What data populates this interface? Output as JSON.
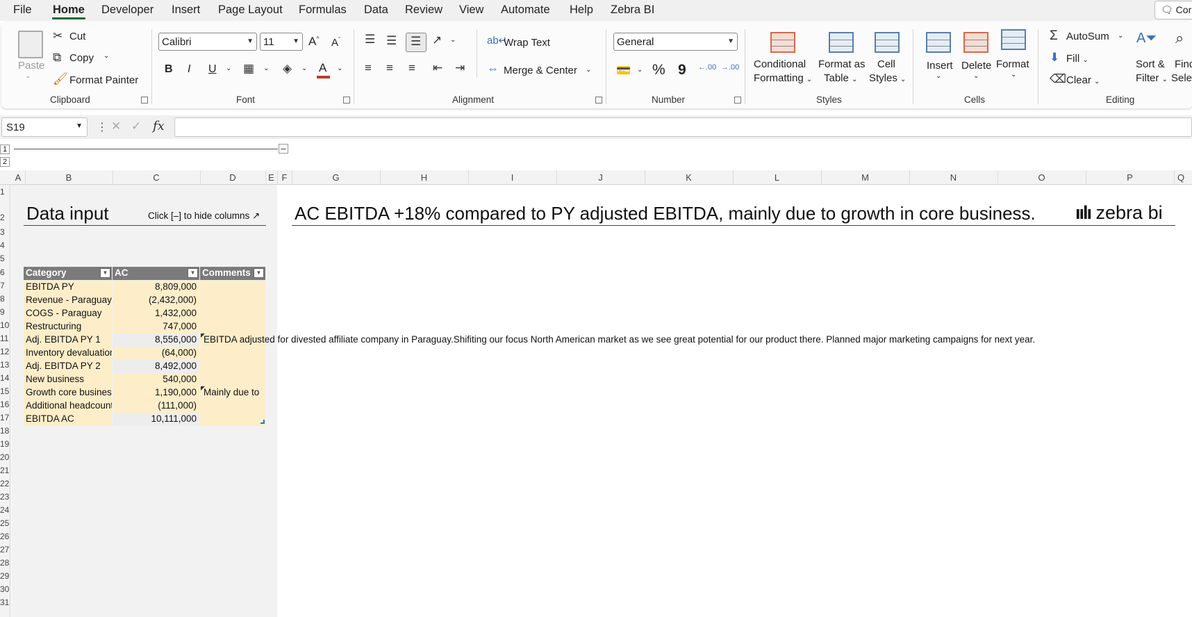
{
  "menu": {
    "tabs": [
      {
        "label": "File"
      },
      {
        "label": "Home"
      },
      {
        "label": "Developer"
      },
      {
        "label": "Insert"
      },
      {
        "label": "Page Layout"
      },
      {
        "label": "Formulas"
      },
      {
        "label": "Data"
      },
      {
        "label": "Review"
      },
      {
        "label": "View"
      },
      {
        "label": "Automate"
      },
      {
        "label": "Help"
      },
      {
        "label": "Zebra BI"
      }
    ],
    "active_tab": "Home",
    "comments_label": "Cor"
  },
  "ribbon": {
    "clipboard": {
      "paste": "Paste",
      "cut": "Cut",
      "copy": "Copy",
      "format_painter": "Format Painter",
      "label": "Clipboard"
    },
    "font": {
      "family": "Calibri",
      "size": "11",
      "label": "Font",
      "bold": "B",
      "italic": "I",
      "underline": "U",
      "grow": "A",
      "shrink": "A",
      "font_color": "A"
    },
    "alignment": {
      "wrap_text": "Wrap Text",
      "merge_center": "Merge & Center",
      "label": "Alignment"
    },
    "number": {
      "format": "General",
      "percent": "%",
      "comma": "9",
      "inc_decimal": ".00",
      "dec_decimal": ".00",
      "label": "Number"
    },
    "styles": {
      "conditional_formatting": "Conditional",
      "conditional_formatting_2": "Formatting",
      "format_as_table": "Format as",
      "format_as_table_2": "Table",
      "cell_styles": "Cell",
      "cell_styles_2": "Styles",
      "label": "Styles"
    },
    "cells": {
      "insert": "Insert",
      "delete": "Delete",
      "format": "Format",
      "label": "Cells"
    },
    "editing": {
      "autosum": "AutoSum",
      "fill": "Fill",
      "clear": "Clear",
      "sort_filter": "Sort &",
      "sort_filter_2": "Filter",
      "find_select": "Find",
      "find_select_2": "Selec",
      "label": "Editing"
    }
  },
  "formula_bar": {
    "name_box": "S19",
    "fx": "fx",
    "content": ""
  },
  "outline": {
    "level1": "1",
    "level2": "2",
    "collapse": "–"
  },
  "columns": [
    "A",
    "B",
    "C",
    "D",
    "E",
    "F",
    "G",
    "H",
    "I",
    "J",
    "K",
    "L",
    "M",
    "N",
    "O",
    "P",
    "Q"
  ],
  "rows": [
    "1",
    "2",
    "3",
    "4",
    "5",
    "6",
    "7",
    "8",
    "9",
    "10",
    "11",
    "12",
    "13",
    "14",
    "15",
    "16",
    "17",
    "18",
    "19",
    "20",
    "21",
    "22",
    "23",
    "24",
    "25",
    "26",
    "27",
    "28",
    "29",
    "30",
    "31"
  ],
  "sheet": {
    "title": "Data input",
    "hide_hint": "Click [–] to hide columns ↗",
    "headline": "AC EBITDA +18% compared to PY adjusted EBITDA, mainly due to growth in core business.",
    "brand": "zebra bi",
    "table": {
      "headers": [
        "Category",
        "AC",
        "Comments"
      ],
      "rows": [
        {
          "category": "EBITDA PY",
          "ac": "8,809,000",
          "comment": ""
        },
        {
          "category": "Revenue  - Paraguay",
          "ac": "(2,432,000)",
          "comment": ""
        },
        {
          "category": "COGS  - Paraguay",
          "ac": "1,432,000",
          "comment": ""
        },
        {
          "category": "Restructuring",
          "ac": "747,000",
          "comment": ""
        },
        {
          "category": "Adj. EBITDA PY 1",
          "ac": "8,556,000",
          "comment": "EBITDA adjusted for divested affiliate company in Paraguay.Shifiting our focus North American market as we see great potential for our product there. Planned major marketing campaigns for next year."
        },
        {
          "category": "Inventory devaluation",
          "ac": "(64,000)",
          "comment": ""
        },
        {
          "category": "Adj. EBITDA PY 2",
          "ac": "8,492,000",
          "comment": ""
        },
        {
          "category": "New business",
          "ac": "540,000",
          "comment": ""
        },
        {
          "category": "Growth core business",
          "ac": "1,190,000",
          "comment": "Mainly due to"
        },
        {
          "category": "Additional headcount",
          "ac": "(111,000)",
          "comment": ""
        },
        {
          "category": "EBITDA AC",
          "ac": "10,111,000",
          "comment": ""
        }
      ]
    }
  }
}
